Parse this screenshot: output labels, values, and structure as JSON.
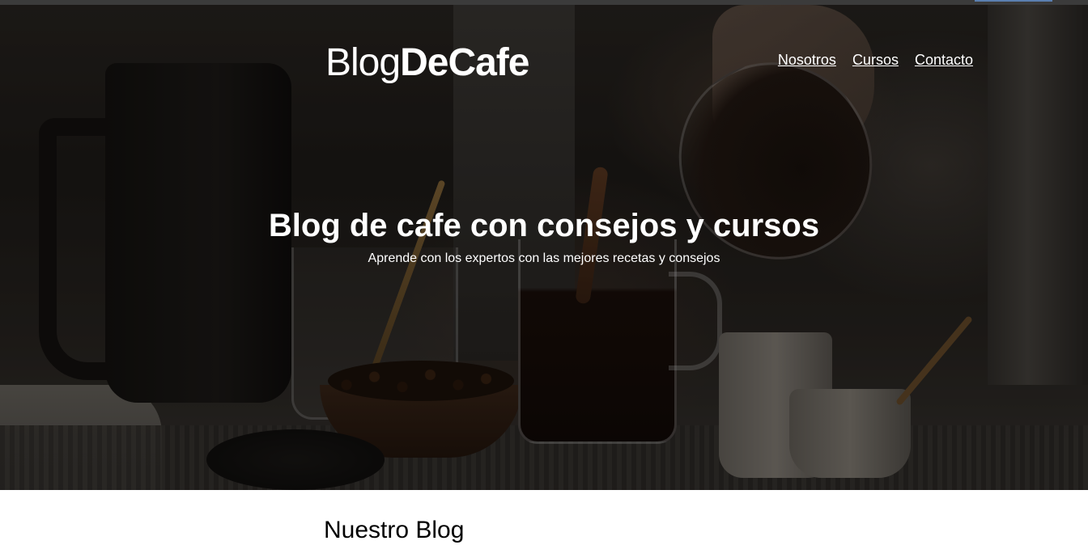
{
  "header": {
    "logo_light": "Blog",
    "logo_bold": "DeCafe",
    "nav": [
      {
        "label": "Nosotros"
      },
      {
        "label": "Cursos"
      },
      {
        "label": "Contacto"
      }
    ]
  },
  "hero": {
    "title": "Blog de cafe con consejos y cursos",
    "subtitle": "Aprende con los expertos con las mejores recetas y consejos",
    "image_icon": "coffee-still-life-photo"
  },
  "main": {
    "section_title": "Nuestro Blog"
  },
  "colors": {
    "hero_text": "#ffffff",
    "page_background": "#ffffff",
    "section_text": "#000000"
  }
}
